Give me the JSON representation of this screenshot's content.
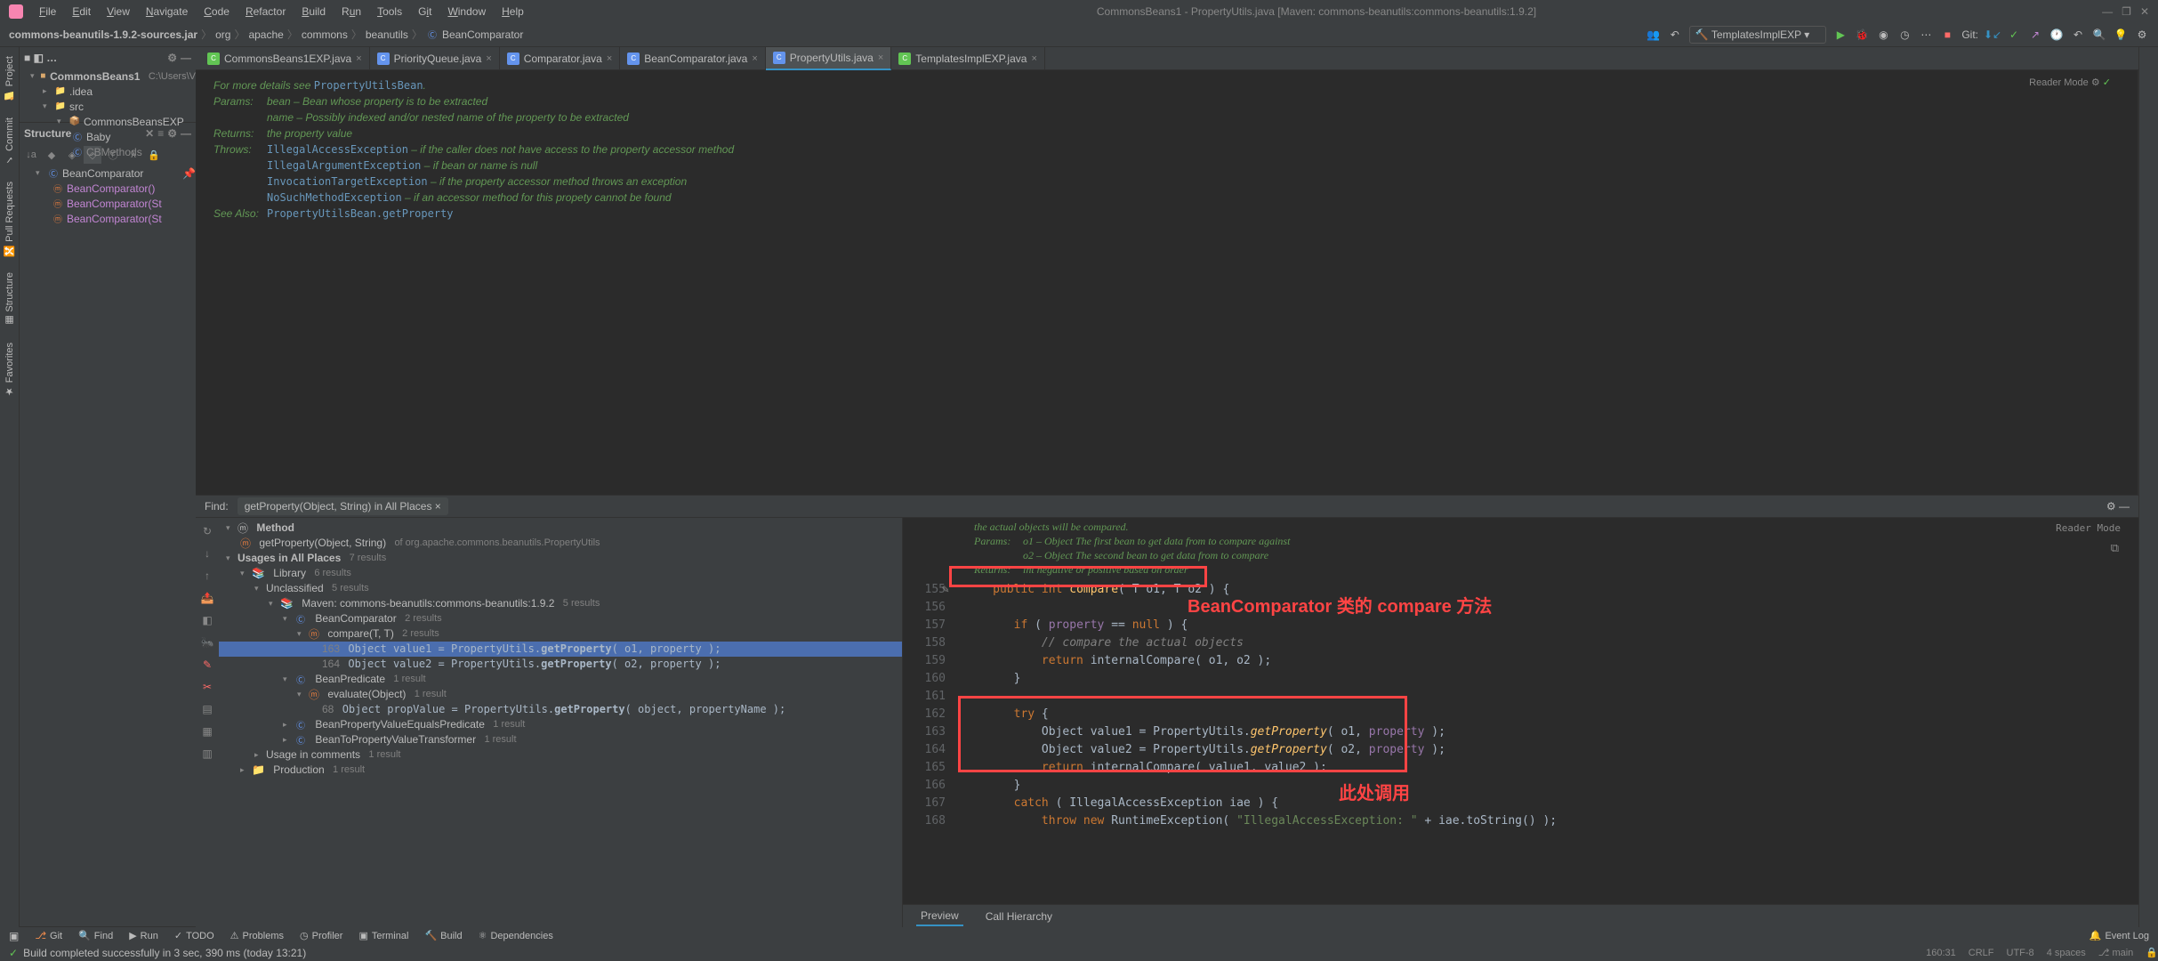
{
  "menu": [
    "File",
    "Edit",
    "View",
    "Navigate",
    "Code",
    "Refactor",
    "Build",
    "Run",
    "Tools",
    "Git",
    "Window",
    "Help"
  ],
  "window_title": "CommonsBeans1 - PropertyUtils.java [Maven: commons-beanutils:commons-beanutils:1.9.2]",
  "breadcrumb": {
    "jar": "commons-beanutils-1.9.2-sources.jar",
    "items": [
      "org",
      "apache",
      "commons",
      "beanutils",
      "BeanComparator"
    ]
  },
  "run_config": "TemplatesImplEXP",
  "git_label": "Git:",
  "project": {
    "root": "CommonsBeans1",
    "root_path": "C:\\Users\\V",
    "idea": ".idea",
    "exp": "CommonsBeansEXP",
    "baby": "Baby",
    "cbm": "CBMethods",
    "src": "src"
  },
  "structure": {
    "class": "BeanComparator",
    "methods": [
      "BeanComparator()",
      "BeanComparator(St",
      "BeanComparator(St"
    ]
  },
  "tabs": [
    {
      "name": "CommonsBeans1EXP.java",
      "active": false
    },
    {
      "name": "PriorityQueue.java",
      "active": false,
      "lib": true
    },
    {
      "name": "Comparator.java",
      "active": false,
      "lib": true
    },
    {
      "name": "BeanComparator.java",
      "active": false,
      "lib": true
    },
    {
      "name": "PropertyUtils.java",
      "active": true,
      "lib": true
    },
    {
      "name": "TemplatesImplEXP.java",
      "active": false
    }
  ],
  "javadoc": {
    "detail": "For more details see ",
    "detail_link": "PropertyUtilsBean",
    "params_label": "Params:",
    "params": [
      "bean – Bean whose property is to be extracted",
      "name – Possibly indexed and/or nested name of the property to be extracted"
    ],
    "returns_label": "Returns:",
    "returns": "the property value",
    "throws_label": "Throws:",
    "throws": [
      {
        "type": "IllegalAccessException",
        "desc": " – if the caller does not have access to the property accessor method"
      },
      {
        "type": "IllegalArgumentException",
        "desc": " – if bean or name is null"
      },
      {
        "type": "InvocationTargetException",
        "desc": " – if the property accessor method throws an exception"
      },
      {
        "type": "NoSuchMethodException",
        "desc": " – if an accessor method for this propety cannot be found"
      }
    ],
    "see_label": "See Also:",
    "see_link": "PropertyUtilsBean.getProperty",
    "reader": "Reader Mode"
  },
  "find": {
    "label": "Find:",
    "query": "getProperty(Object, String) in All Places"
  },
  "usages": {
    "method_label": "Method",
    "method": "getProperty(Object, String)",
    "method_of": "of org.apache.commons.beanutils.PropertyUtils",
    "root": "Usages in All Places",
    "root_count": "7 results",
    "lib": "Library",
    "lib_count": "6 results",
    "unclass": "Unclassified",
    "unclass_count": "5 results",
    "maven": "Maven: commons-beanutils:commons-beanutils:1.9.2",
    "maven_count": "5 results",
    "bc": "BeanComparator",
    "bc_count": "2 results",
    "compare": "compare(T, T)",
    "compare_count": "2 results",
    "u1_line": "163",
    "u1_code": "Object value1 = PropertyUtils.getProperty( o1, property );",
    "u2_line": "164",
    "u2_code": "Object value2 = PropertyUtils.getProperty( o2, property );",
    "bp": "BeanPredicate",
    "bp_count": "1 result",
    "eval": "evaluate(Object)",
    "eval_count": "1 result",
    "u3_line": "68",
    "u3_code": "Object propValue = PropertyUtils.getProperty( object, propertyName );",
    "bpve": "BeanPropertyValueEqualsPredicate",
    "bpve_count": "1 result",
    "btpvt": "BeanToPropertyValueTransformer",
    "btpvt_count": "1 result",
    "comments": "Usage in comments",
    "comments_count": "1 result",
    "prod": "Production",
    "prod_count": "1 result"
  },
  "code_docs": {
    "line0": "the actual objects will be compared.",
    "p_label": "Params:",
    "p1": "o1 – Object The first bean to get data from to compare against",
    "p2": "o2 – Object The second bean to get data from to compare",
    "r_label": "Returns:",
    "r": "int negative or positive based on order",
    "reader": "Reader Mode"
  },
  "code_lines": [
    "155",
    "156",
    "157",
    "158",
    "159",
    "160",
    "161",
    "162",
    "163",
    "164",
    "165",
    "166",
    "167",
    "168"
  ],
  "annotations": {
    "red1": "BeanComparator 类的 compare 方法",
    "red2": "此处调用"
  },
  "preview_tabs": [
    "Preview",
    "Call Hierarchy"
  ],
  "status": {
    "items": [
      "Git",
      "Find",
      "Run",
      "TODO",
      "Problems",
      "Profiler",
      "Terminal",
      "Build",
      "Dependencies"
    ],
    "build": "Build completed successfully in 3 sec, 390 ms (today 13:21)",
    "pos": "160:31",
    "crlf": "CRLF",
    "enc": "UTF-8",
    "indent": "4 spaces",
    "branch": "main",
    "event": "Event Log"
  }
}
